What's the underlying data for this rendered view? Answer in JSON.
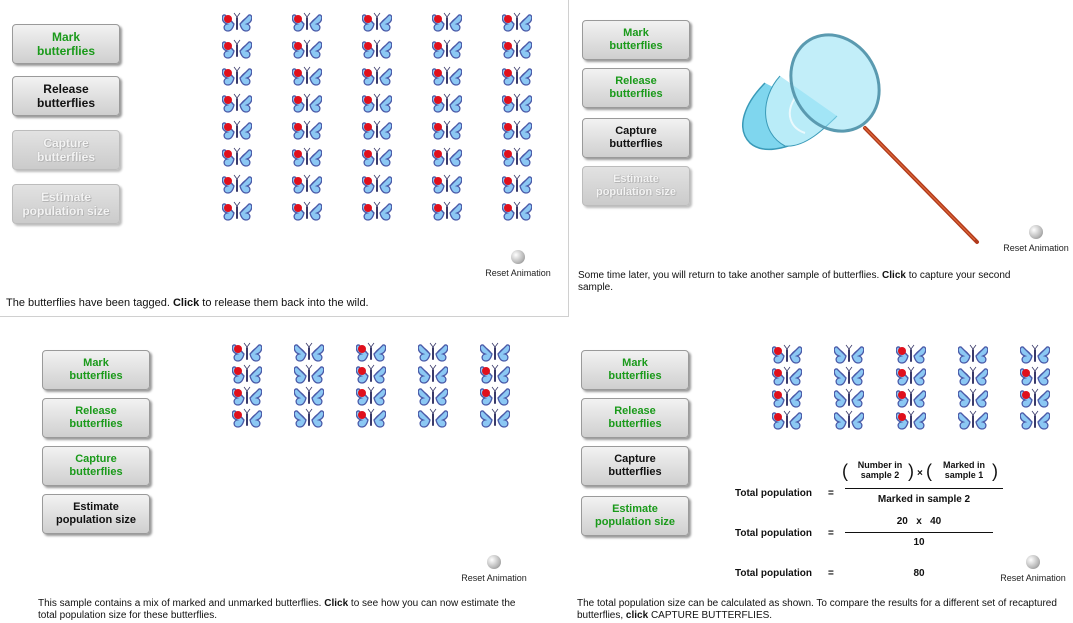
{
  "reset_label": "Reset Animation",
  "colors": {
    "wing_blue": "#8cc8f4",
    "wing_outline": "#4a5aa8",
    "marker_red": "#e0101c",
    "button_green": "#1a9a1a"
  },
  "panel1": {
    "buttons": [
      "Mark\nbutterflies",
      "Release\nbutterflies",
      "Capture\nbutterflies",
      "Estimate\npopulation size"
    ],
    "caption_pre": "The butterflies have been tagged. ",
    "caption_bold": "Click",
    "caption_post": " to release them back into the wild.",
    "butterflies": {
      "columns": 5,
      "rows": 8,
      "marked": "all"
    }
  },
  "panel2": {
    "buttons": [
      "Mark\nbutterflies",
      "Release\nbutterflies",
      "Capture\nbutterflies",
      "Estimate\npopulation size"
    ],
    "caption_pre": "Some time later, you will return to take another sample of butterflies. ",
    "caption_bold": "Click",
    "caption_post": " to capture your second sample.",
    "image": "butterfly-net-icon"
  },
  "panel3": {
    "buttons": [
      "Mark\nbutterflies",
      "Release\nbutterflies",
      "Capture\nbutterflies",
      "Estimate\npopulation size"
    ],
    "caption_pre": "This sample contains a mix of marked and unmarked butterflies. ",
    "caption_bold": "Click",
    "caption_post": " to see how you can now estimate the total population size for these butterflies.",
    "butterflies": {
      "columns": 5,
      "rows": 4,
      "marked_count": 10
    }
  },
  "panel4": {
    "buttons": [
      "Mark\nbutterflies",
      "Release\nbutterflies",
      "Capture\nbutterflies",
      "Estimate\npopulation size"
    ],
    "caption_pre": "The total population size can be calculated as shown. To compare the results for a different set of recaptured butterflies, ",
    "caption_bold": "click",
    "caption_post": " CAPTURE BUTTERFLIES.",
    "butterflies": {
      "columns": 5,
      "rows": 4,
      "marked_count": 10
    },
    "formula": {
      "label": "Total population",
      "equals": "=",
      "numerator_a": "Number in\nsample 2",
      "times": "×",
      "numerator_b": "Marked in\nsample 1",
      "denominator": "Marked in sample 2",
      "values_numerator": "20   x   40",
      "values_denominator": "10",
      "result": "80"
    }
  }
}
